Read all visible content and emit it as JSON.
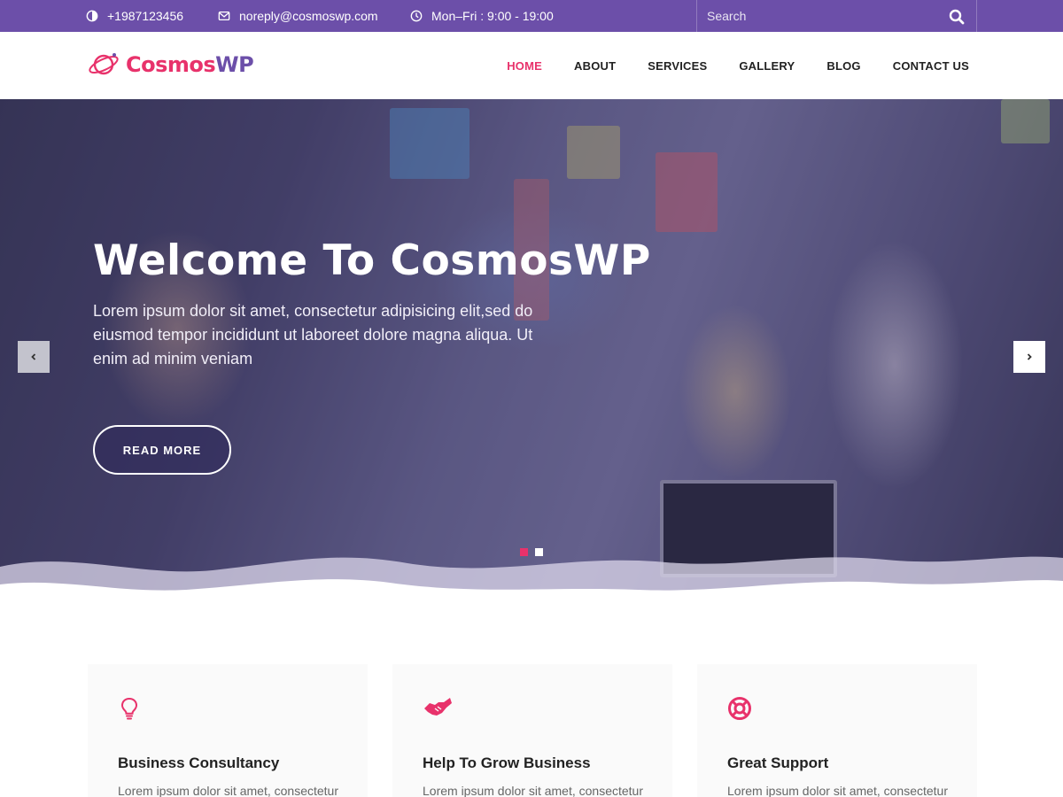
{
  "topbar": {
    "phone": "+1987123456",
    "email": "noreply@cosmoswp.com",
    "hours": "Mon–Fri : 9:00 - 19:00",
    "search_placeholder": "Search"
  },
  "brand": {
    "name_part1": "Cosmos",
    "name_part2": "WP",
    "color_primary": "#e8326b",
    "color_secondary": "#6c4fa9"
  },
  "nav": {
    "items": [
      {
        "label": "HOME",
        "active": true
      },
      {
        "label": "ABOUT"
      },
      {
        "label": "SERVICES"
      },
      {
        "label": "GALLERY"
      },
      {
        "label": "BLOG"
      },
      {
        "label": "CONTACT US"
      }
    ]
  },
  "hero": {
    "title": "Welcome To CosmosWP",
    "text": "Lorem ipsum dolor sit amet, consectetur adipisicing elit,sed do eiusmod tempor incididunt ut laboreet dolore magna aliqua. Ut enim ad minim veniam",
    "button": "READ MORE",
    "prev_icon": "chevron-left-icon",
    "next_icon": "chevron-right-icon",
    "slides": 2,
    "active_slide": 1
  },
  "features": [
    {
      "icon": "lightbulb-icon",
      "title": "Business Consultancy",
      "desc": "Lorem ipsum dolor sit amet, consectetur"
    },
    {
      "icon": "handshake-icon",
      "title": "Help To Grow Business",
      "desc": "Lorem ipsum dolor sit amet, consectetur"
    },
    {
      "icon": "lifebuoy-icon",
      "title": "Great Support",
      "desc": "Lorem ipsum dolor sit amet, consectetur"
    }
  ]
}
